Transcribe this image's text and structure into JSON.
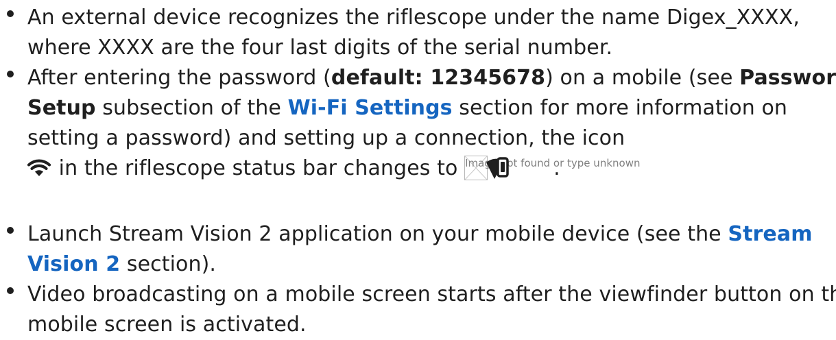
{
  "items": [
    {
      "text": "An external device recognizes the riflescope under the name Digex_XXXX, where XXXX are the four last digits of the serial number."
    },
    {
      "text_a": "After entering the password (",
      "bold_default": "default: 12345678",
      "text_b": ") on a mobile (see ",
      "bold_password_setup": "Password Setup",
      "text_c": " subsection of the ",
      "link_wifi_settings": "Wi-Fi Settings",
      "text_d": " section for more information on setting a password) and setting up a connection, the icon ",
      "text_e": " in the riflescope status bar changes to ",
      "broken_image_alt": "Image not found or type unknown",
      "text_f": "."
    },
    {
      "text_a": "Launch Stream Vision 2 application on your mobile device (see the ",
      "link_stream_vision": "Stream Vision 2",
      "text_b": " section)."
    },
    {
      "text": "Video broadcasting on a mobile screen starts after the viewfinder button on the mobile screen is activated."
    }
  ],
  "icons": {
    "wifi": "wifi-icon",
    "phone_connected": "phone-wifi-icon",
    "broken_image": "broken-image-icon"
  },
  "colors": {
    "text": "#1f1f1f",
    "link": "#1565c0",
    "muted": "#808080"
  }
}
